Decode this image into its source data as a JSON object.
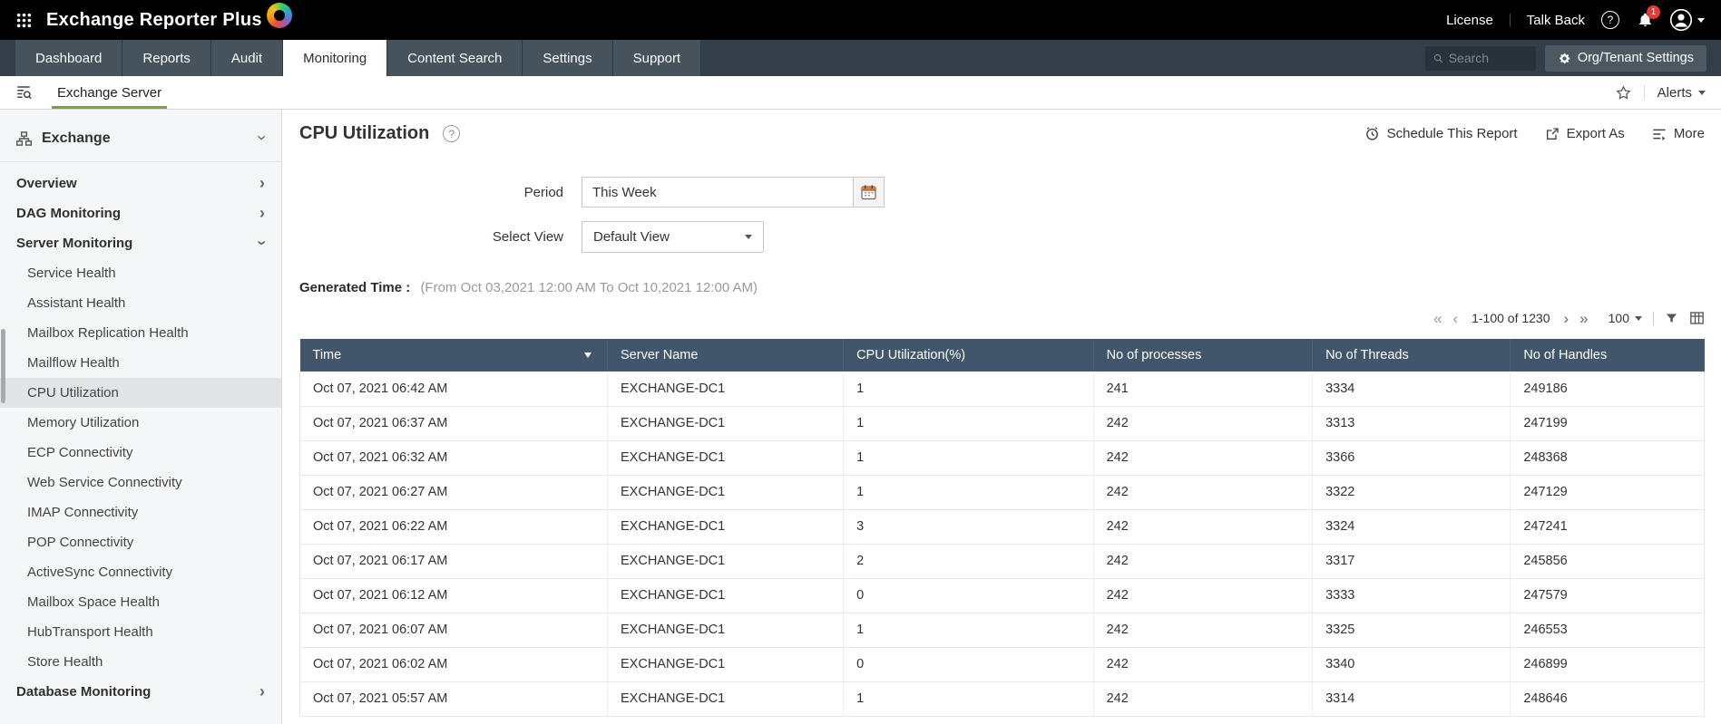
{
  "topbar": {
    "app_name": "Exchange Reporter Plus",
    "license": "License",
    "talkback": "Talk Back",
    "notification_count": "1"
  },
  "nav": {
    "tabs": [
      {
        "label": "Dashboard"
      },
      {
        "label": "Reports"
      },
      {
        "label": "Audit"
      },
      {
        "label": "Monitoring",
        "active": true
      },
      {
        "label": "Content Search"
      },
      {
        "label": "Settings"
      },
      {
        "label": "Support"
      }
    ],
    "search_placeholder": "Search",
    "org_settings": "Org/Tenant Settings"
  },
  "subnav": {
    "tab_label": "Exchange Server",
    "alerts_label": "Alerts"
  },
  "sidebar": {
    "root_label": "Exchange",
    "items": [
      {
        "label": "Overview",
        "collapsible": true
      },
      {
        "label": "DAG Monitoring",
        "collapsible": true
      },
      {
        "label": "Server Monitoring",
        "collapsible": true,
        "expanded": true
      },
      {
        "label": "Service Health",
        "child": true
      },
      {
        "label": "Assistant Health",
        "child": true
      },
      {
        "label": "Mailbox Replication Health",
        "child": true
      },
      {
        "label": "Mailflow Health",
        "child": true
      },
      {
        "label": "CPU Utilization",
        "child": true,
        "selected": true
      },
      {
        "label": "Memory Utilization",
        "child": true
      },
      {
        "label": "ECP Connectivity",
        "child": true
      },
      {
        "label": "Web Service Connectivity",
        "child": true
      },
      {
        "label": "IMAP Connectivity",
        "child": true
      },
      {
        "label": "POP Connectivity",
        "child": true
      },
      {
        "label": "ActiveSync Connectivity",
        "child": true
      },
      {
        "label": "Mailbox Space Health",
        "child": true
      },
      {
        "label": "HubTransport Health",
        "child": true
      },
      {
        "label": "Store Health",
        "child": true
      },
      {
        "label": "Database Monitoring",
        "collapsible": true
      }
    ]
  },
  "report": {
    "title": "CPU Utilization",
    "actions": {
      "schedule": "Schedule This Report",
      "export": "Export As",
      "more": "More"
    },
    "filters": {
      "period_label": "Period",
      "period_value": "This Week",
      "view_label": "Select View",
      "view_value": "Default View"
    },
    "generated_label": "Generated Time :",
    "generated_value": "(From Oct 03,2021 12:00 AM To Oct 10,2021 12:00 AM)",
    "pagination": {
      "range": "1-100 of 1230",
      "page_size": "100"
    },
    "table": {
      "columns": [
        {
          "label": "Time",
          "sorted": true
        },
        {
          "label": "Server Name"
        },
        {
          "label": "CPU Utilization(%)"
        },
        {
          "label": "No of processes"
        },
        {
          "label": "No of Threads"
        },
        {
          "label": "No of Handles"
        }
      ],
      "rows": [
        [
          "Oct 07, 2021 06:42 AM",
          "EXCHANGE-DC1",
          "1",
          "241",
          "3334",
          "249186"
        ],
        [
          "Oct 07, 2021 06:37 AM",
          "EXCHANGE-DC1",
          "1",
          "242",
          "3313",
          "247199"
        ],
        [
          "Oct 07, 2021 06:32 AM",
          "EXCHANGE-DC1",
          "1",
          "242",
          "3366",
          "248368"
        ],
        [
          "Oct 07, 2021 06:27 AM",
          "EXCHANGE-DC1",
          "1",
          "242",
          "3322",
          "247129"
        ],
        [
          "Oct 07, 2021 06:22 AM",
          "EXCHANGE-DC1",
          "3",
          "242",
          "3324",
          "247241"
        ],
        [
          "Oct 07, 2021 06:17 AM",
          "EXCHANGE-DC1",
          "2",
          "242",
          "3317",
          "245856"
        ],
        [
          "Oct 07, 2021 06:12 AM",
          "EXCHANGE-DC1",
          "0",
          "242",
          "3333",
          "247579"
        ],
        [
          "Oct 07, 2021 06:07 AM",
          "EXCHANGE-DC1",
          "1",
          "242",
          "3325",
          "246553"
        ],
        [
          "Oct 07, 2021 06:02 AM",
          "EXCHANGE-DC1",
          "0",
          "242",
          "3340",
          "246899"
        ],
        [
          "Oct 07, 2021 05:57 AM",
          "EXCHANGE-DC1",
          "1",
          "242",
          "3314",
          "248646"
        ]
      ]
    }
  },
  "colors": {
    "accent_green": "#76a540",
    "header_slate": "#42566b",
    "badge_red": "#e53935"
  }
}
